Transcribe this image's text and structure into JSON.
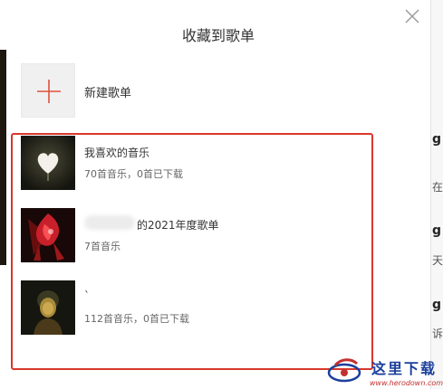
{
  "dialog": {
    "title": "收藏到歌单",
    "create_label": "新建歌单"
  },
  "playlists": [
    {
      "name": "我喜欢的音乐",
      "meta": "70首音乐，0首已下载"
    },
    {
      "name": "的2021年度歌单",
      "meta": "7首音乐"
    },
    {
      "name": "`",
      "meta": "112首音乐，0首已下载"
    }
  ],
  "background": {
    "fragments": [
      {
        "text": "g",
        "bold": true
      },
      {
        "text": "在",
        "bold": false
      },
      {
        "text": "g",
        "bold": true
      },
      {
        "text": "天的",
        "bold": false
      },
      {
        "text": "g",
        "bold": true
      },
      {
        "text": "诉",
        "bold": false
      }
    ]
  },
  "watermark": {
    "text": "这里下载",
    "url": "www.herodown.com"
  },
  "colors": {
    "accent_red": "#d9372b",
    "plus_red": "#e0503c",
    "watermark_blue": "#1b3f9c"
  }
}
